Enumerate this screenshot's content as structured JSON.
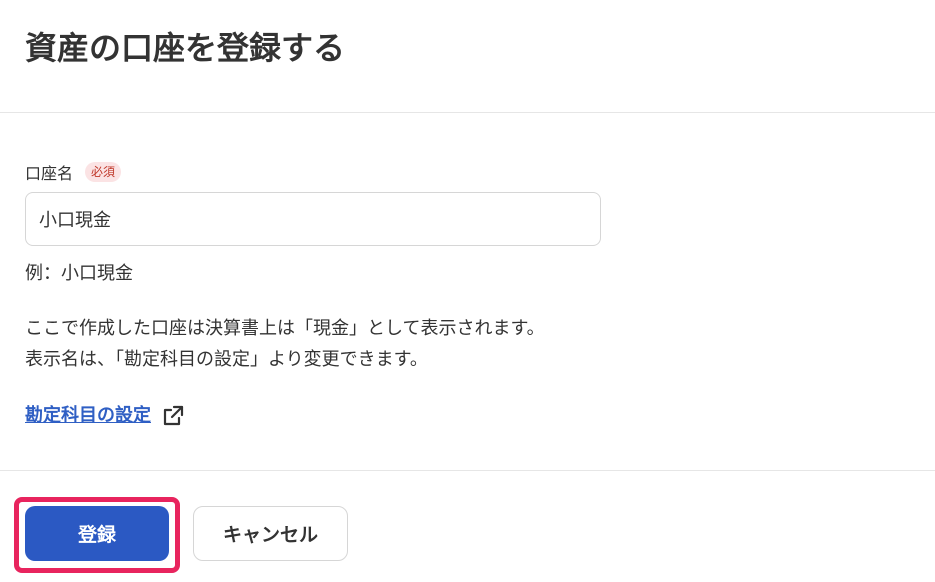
{
  "header": {
    "title": "資産の口座を登録する"
  },
  "form": {
    "account_name": {
      "label": "口座名",
      "required_badge": "必須",
      "value": "小口現金",
      "example": "例：小口現金"
    },
    "notes": [
      "ここで作成した口座は決算書上は「現金」として表示されます。",
      "表示名は、「勘定科目の設定」より変更できます。"
    ],
    "settings_link": {
      "label": "勘定科目の設定",
      "icon": "external-link-icon"
    }
  },
  "footer": {
    "register_label": "登録",
    "cancel_label": "キャンセル"
  },
  "colors": {
    "primary": "#2b59c3",
    "link": "#2f5fc4",
    "required_text": "#c0392b",
    "required_bg": "#fbe3e4",
    "highlight": "#e8245e"
  }
}
